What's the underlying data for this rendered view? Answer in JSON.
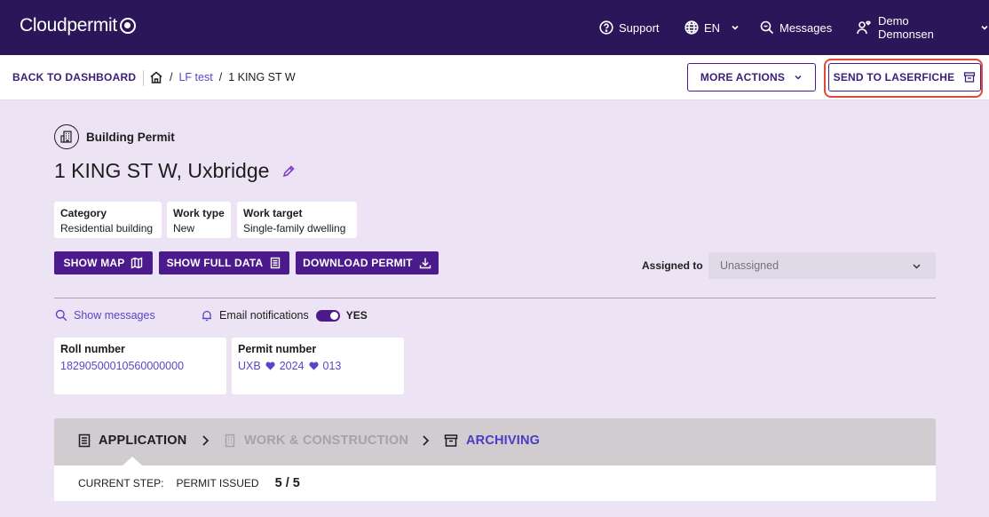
{
  "brand": {
    "name": "Cloudpermit"
  },
  "topnav": {
    "support": "Support",
    "language": "EN",
    "messages": "Messages",
    "user": "Demo Demonsen"
  },
  "actionbar": {
    "back": "BACK TO DASHBOARD",
    "breadcrumb": {
      "sep": "/",
      "project": "LF test",
      "current": "1 KING ST W"
    },
    "more_actions": "MORE ACTIONS",
    "send": "SEND TO LASERFICHE"
  },
  "permit": {
    "type": "Building Permit",
    "title": "1 KING ST W, Uxbridge",
    "attributes": [
      {
        "label": "Category",
        "value": "Residential building"
      },
      {
        "label": "Work type",
        "value": "New"
      },
      {
        "label": "Work target",
        "value": "Single-family dwelling"
      }
    ]
  },
  "buttons": {
    "show_map": "SHOW MAP",
    "show_full_data": "SHOW FULL DATA",
    "download_permit": "DOWNLOAD PERMIT"
  },
  "assigned": {
    "label": "Assigned to",
    "value": "Unassigned"
  },
  "messages": {
    "show": "Show messages",
    "email_notifications": "Email notifications",
    "email_state": "YES"
  },
  "roll": {
    "label": "Roll number",
    "value": "18290500010560000000"
  },
  "permit_number": {
    "label": "Permit number",
    "parts": [
      "UXB",
      "2024",
      "013"
    ]
  },
  "stepper": {
    "steps": [
      {
        "label": "APPLICATION",
        "state": "active"
      },
      {
        "label": "WORK & CONSTRUCTION",
        "state": "disabled"
      },
      {
        "label": "ARCHIVING",
        "state": "link"
      }
    ],
    "current_label": "CURRENT STEP:",
    "current_step": "PERMIT ISSUED",
    "progress": "5 / 5"
  },
  "colors": {
    "topbar": "#2a1658",
    "primary": "#4b1a8c",
    "link": "#5a45c9",
    "page_bg": "#ece4f5",
    "highlight": "#e0493b"
  }
}
